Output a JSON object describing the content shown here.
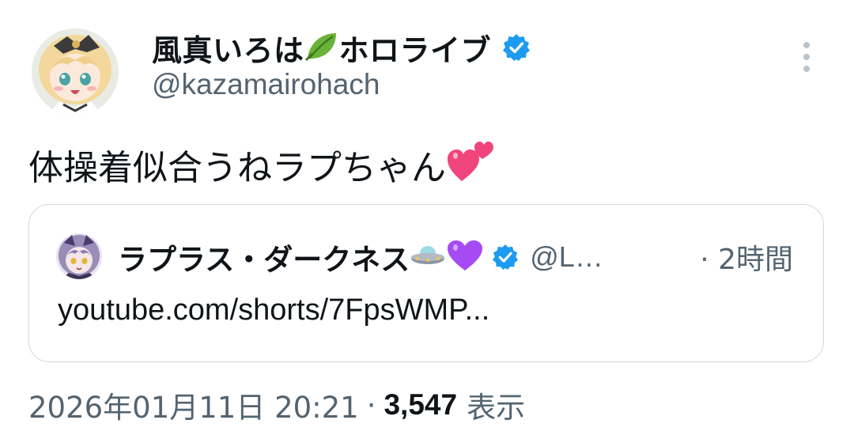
{
  "author": {
    "display_name": "風真いろは",
    "name_suffix": "ホロライブ",
    "handle": "@kazamairohach",
    "name_emoji_icon": "leaf-icon",
    "verified": true,
    "verified_color": "#1d9bf0"
  },
  "tweet": {
    "text": "体操着似合うねラプちゃん",
    "trailing_emoji_icon": "two-hearts-icon"
  },
  "quote": {
    "display_name": "ラプラス・ダークネス",
    "emoji_icons": [
      "ufo-icon",
      "purple-heart-icon"
    ],
    "verified": true,
    "handle": "@L…",
    "time": "· 2時間",
    "link_text": "youtube.com/shorts/7FpsWMP..."
  },
  "meta": {
    "timestamp": "2026年01月11日 20:21",
    "separator": "·",
    "view_count": "3,547",
    "view_label": "表示"
  },
  "colors": {
    "text_primary": "#0f1419",
    "text_secondary": "#536471",
    "border": "#cfd9de",
    "verified_blue": "#1d9bf0"
  }
}
